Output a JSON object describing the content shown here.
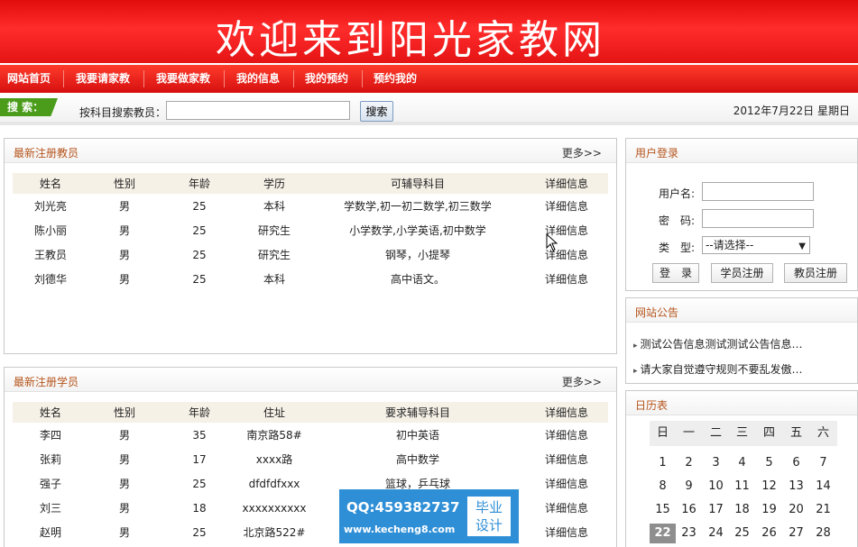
{
  "banner": {
    "title": "欢迎来到阳光家教网"
  },
  "nav": {
    "items": [
      "网站首页",
      "我要请家教",
      "我要做家教",
      "我的信息",
      "我的预约",
      "预约我的"
    ]
  },
  "search": {
    "tag": "搜 索：",
    "label": "按科目搜索教员：",
    "value": "",
    "button": "搜索"
  },
  "date": "2012年7月22日  星期日",
  "teachers_panel": {
    "title": "最新注册教员",
    "more": "更多>>",
    "headers": [
      "姓名",
      "性别",
      "年龄",
      "学历",
      "可辅导科目",
      "详细信息"
    ],
    "rows": [
      [
        "刘光亮",
        "男",
        "25",
        "本科",
        "学数学,初一初二数学,初三数学",
        "详细信息"
      ],
      [
        "陈小丽",
        "男",
        "25",
        "研究生",
        "小学数学,小学英语,初中数学",
        "详细信息"
      ],
      [
        "王教员",
        "男",
        "25",
        "研究生",
        "钢琴，小提琴",
        "详细信息"
      ],
      [
        "刘德华",
        "男",
        "25",
        "本科",
        "高中语文。",
        "详细信息"
      ]
    ]
  },
  "students_panel": {
    "title": "最新注册学员",
    "more": "更多>>",
    "headers": [
      "姓名",
      "性别",
      "年龄",
      "住址",
      "要求辅导科目",
      "详细信息"
    ],
    "rows": [
      [
        "李四",
        "男",
        "35",
        "南京路58#",
        "初中英语",
        "详细信息"
      ],
      [
        "张莉",
        "男",
        "17",
        "xxxx路",
        "高中数学",
        "详细信息"
      ],
      [
        "强子",
        "男",
        "25",
        "dfdfdfxxx",
        "篮球，乒乓球",
        "详细信息"
      ],
      [
        "刘三",
        "男",
        "18",
        "xxxxxxxxxx",
        "",
        "详细信息"
      ],
      [
        "赵明",
        "男",
        "25",
        "北京路522#",
        "",
        "详细信息"
      ]
    ]
  },
  "login": {
    "title": "用户登录",
    "username_label": "用户名:",
    "password_label": "密　码:",
    "type_label": "类　型:",
    "type_selected": "--请选择--",
    "login_button": "登　录",
    "student_register": "学员注册",
    "teacher_register": "教员注册"
  },
  "notice": {
    "title": "网站公告",
    "items": [
      "测试公告信息测试测试公告信息…",
      "请大家自觉遵守规则不要乱发傲…"
    ]
  },
  "calendar": {
    "title": "日历表",
    "weekdays": [
      "日",
      "一",
      "二",
      "三",
      "四",
      "五",
      "六"
    ],
    "weeks": [
      [
        "1",
        "2",
        "3",
        "4",
        "5",
        "6",
        "7"
      ],
      [
        "8",
        "9",
        "10",
        "11",
        "12",
        "13",
        "14"
      ],
      [
        "15",
        "16",
        "17",
        "18",
        "19",
        "20",
        "21"
      ],
      [
        "22",
        "23",
        "24",
        "25",
        "26",
        "27",
        "28"
      ]
    ],
    "today": "22"
  },
  "watermark": {
    "qq": "QQ:459382737",
    "url": "www.kecheng8.com",
    "box_line1": "毕业",
    "box_line2": "设计"
  }
}
